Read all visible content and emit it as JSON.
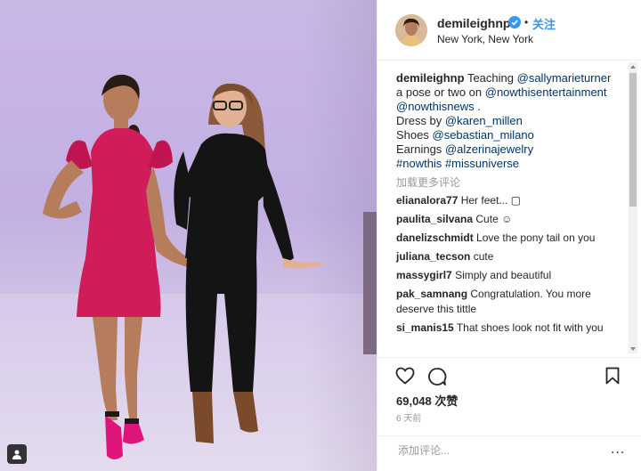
{
  "post": {
    "username": "demileighnp",
    "follow_label": "关注",
    "dot": "•",
    "location": "New York, New York",
    "caption": {
      "user": "demileighnp",
      "p1": "Teaching",
      "m1": "@sallymarieturner",
      "p2": "a pose or two on",
      "m2": "@nowthisentertainment",
      "m3": "@nowthisnews",
      "p3": ".",
      "p4": "Dress by",
      "m4": "@karen_millen",
      "p5": "Shoes",
      "m5": "@sebastian_milano",
      "p6": "Earnings",
      "m6": "@alzerinajewelry",
      "m7": "#nowthis",
      "m8": "#missuniverse"
    },
    "load_more": "加载更多评论",
    "comments": [
      {
        "user": "elianalora77",
        "text": "Her feet... ▢"
      },
      {
        "user": "paulita_silvana",
        "text": "Cute ☺"
      },
      {
        "user": "danelizschmidt",
        "text": "Love the pony tail on you"
      },
      {
        "user": "juliana_tecson",
        "text": "cute"
      },
      {
        "user": "massygirl7",
        "text": "Simply and beautiful"
      },
      {
        "user": "pak_samnang",
        "text": "Congratulation. You more deserve this tittle"
      },
      {
        "user": "si_manis15",
        "text": "That shoes look not fit with you"
      }
    ],
    "likes": "69,048 次赞",
    "time_ago": "6 天前",
    "add_comment_placeholder": "添加评论...",
    "more_options": "...",
    "colors": {
      "link": "#003569",
      "follow": "#3897f0",
      "verified": "#3897f0",
      "muted": "#999999",
      "dress": "#d01d5a"
    },
    "icons": [
      "heart-icon",
      "comment-icon",
      "bookmark-icon",
      "verified-badge-icon",
      "user-tag-icon"
    ]
  }
}
